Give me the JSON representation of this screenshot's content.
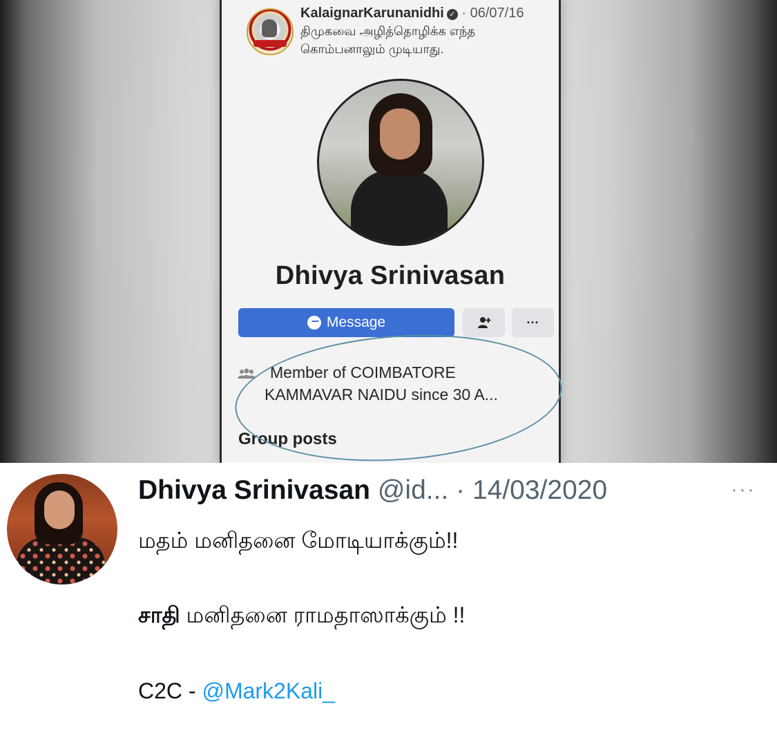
{
  "facebook_screenshot": {
    "post_author": "KalaignarKarunanidhi",
    "post_date": "· 06/07/16",
    "post_text": "திமுகவை அழித்தொழிக்க எந்த கொம்பனாலும் முடியாது.",
    "profile_name": "Dhivya Srinivasan",
    "message_button": "Message",
    "more_button": "···",
    "member_line_1": "Member of COIMBATORE",
    "member_line_2": "KAMMAVAR NAIDU since 30 A...",
    "group_posts": "Group posts"
  },
  "tweet": {
    "name": "Dhivya Srinivasan",
    "handle_date": "@id... · 14/03/2020",
    "more": "···",
    "line1": "மதம் மனிதனை மோடியாக்கும்!!",
    "line2_bold": "சாதி",
    "line2_rest": "மனிதனை ராமதாஸாக்கும் !!",
    "line3_prefix": "C2C - ",
    "line3_handle": "@Mark2Kali_"
  },
  "colors": {
    "message_button": "#3b6fd4",
    "annotation_circle": "#5a8fa6",
    "link": "#1d9bf0"
  }
}
